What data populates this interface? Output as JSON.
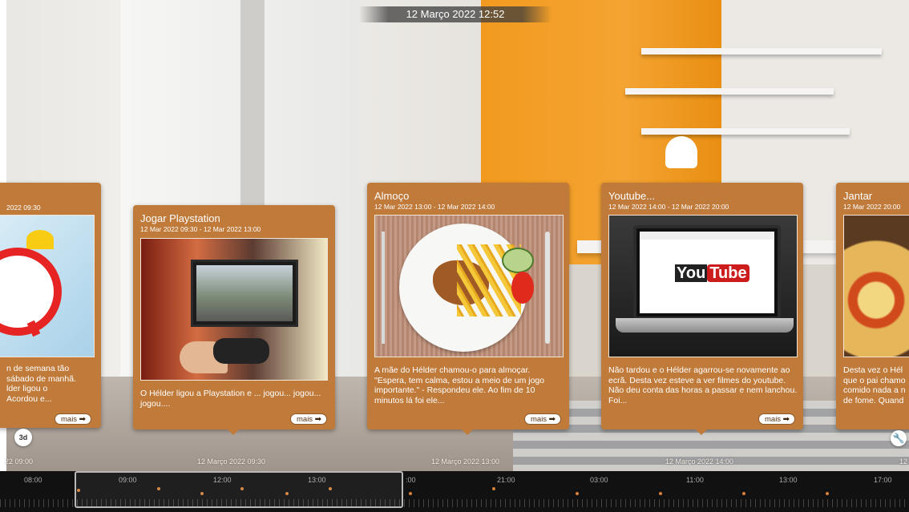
{
  "header": {
    "datetime": "12 Março 2022 12:52"
  },
  "cards": [
    {
      "id": "wake",
      "title": "",
      "dates": "2022 09:30",
      "description": "n de semana tão\nsábado de manhã.\nlder ligou o\nAcordou e...",
      "more_label": "mais"
    },
    {
      "id": "playstation",
      "title": "Jogar Playstation",
      "dates": "12 Mar 2022 09:30 - 12 Mar 2022 13:00",
      "description": "O Hélder ligou a Playstation e ... jogou... jogou... jogou....",
      "more_label": "mais"
    },
    {
      "id": "lunch",
      "title": "Almoço",
      "dates": "12 Mar 2022 13:00 - 12 Mar 2022 14:00",
      "description": "A mãe do Hélder chamou-o para almoçar. \"Espera, tem calma, estou a meio de um jogo importante.\" - Respondeu ele. Ao fim de 10 minutos lá foi ele...",
      "more_label": "mais"
    },
    {
      "id": "youtube",
      "title": "Youtube...",
      "dates": "12 Mar 2022 14:00 - 12 Mar 2022 20:00",
      "description": "Não tardou e o Hélder agarrou-se novamente ao ecrã. Desta vez esteve a ver filmes do youtube. Não deu conta das horas a passar e nem lanchou. Foi...",
      "more_label": "mais"
    },
    {
      "id": "dinner",
      "title": "Jantar",
      "dates": "12 Mar 2022 20:00",
      "description": "Desta vez o Hél\nque o pai chamo\ncomido nada a n\nde fome. Quand",
      "more_label": "mais"
    }
  ],
  "badges": {
    "zoom": "3d",
    "settings_icon": "wrench-icon"
  },
  "date_strip": [
    "22 09:00",
    "12 Março 2022 09:30",
    "12 Março 2022 13:00",
    "12 Março 2022 14:00",
    "12"
  ],
  "timeline": {
    "hours": [
      "08:00",
      "09:00",
      "12:00",
      "13:00",
      ":00",
      "21:00",
      "03:00",
      "11:00",
      "13:00",
      "17:00"
    ]
  },
  "colors": {
    "card": "#c07a3a",
    "accent": "#f29a1f",
    "timeline_bg": "#111111"
  }
}
